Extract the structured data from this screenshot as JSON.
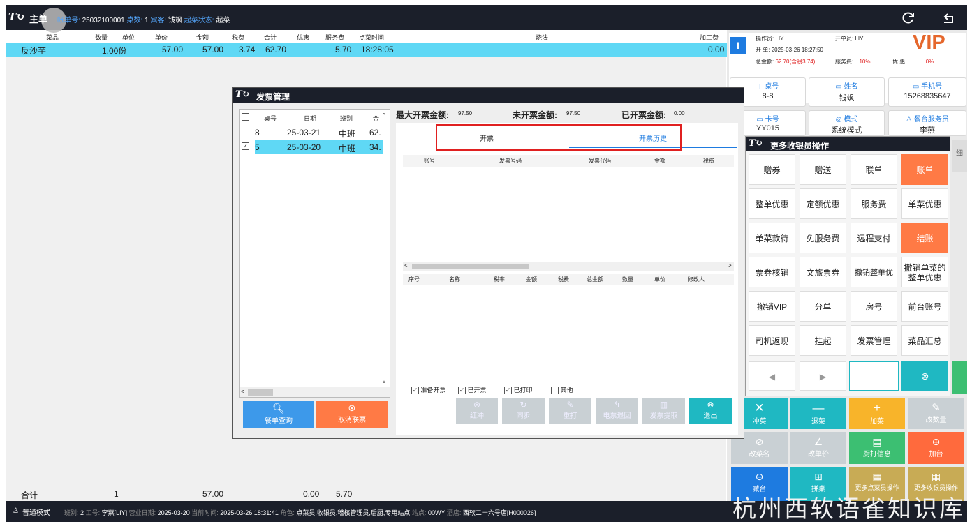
{
  "header": {
    "title": "主单",
    "order_no_label": "帐单号:",
    "order_no": "25032100001",
    "tables_label": "桌数:",
    "tables": "1",
    "guest_label": "宾客:",
    "guest": "钱飒",
    "status_label": "起菜状态:",
    "status": "起菜"
  },
  "table": {
    "columns": [
      "菜品",
      "数量",
      "单位",
      "单价",
      "金额",
      "税费",
      "合计",
      "优惠",
      "服务费",
      "点菜时间",
      "烧法",
      "加工费"
    ],
    "row": {
      "name": "反沙芋",
      "qty": "1.00份",
      "price": "57.00",
      "amount": "57.00",
      "tax": "3.74",
      "total": "62.70",
      "service": "5.70",
      "time": "18:28:05",
      "fee": "0.00"
    }
  },
  "summary": {
    "label": "合计",
    "qty": "1",
    "amount": "57.00",
    "discount": "0.00",
    "service": "5.70"
  },
  "dialog": {
    "title": "发票管理",
    "list_cols": [
      "桌号",
      "日期",
      "班别",
      "金"
    ],
    "rows": [
      {
        "no": "8",
        "date": "25-03-21",
        "shift": "中班",
        "amt": "62.",
        "checked": "",
        "sel": false
      },
      {
        "no": "5",
        "date": "25-03-20",
        "shift": "中班",
        "amt": "34.",
        "checked": "✓",
        "sel": true
      }
    ],
    "max_label": "最大开票金额:",
    "max_val": "97.50",
    "un_label": "未开票金额:",
    "un_val": "97.50",
    "done_label": "已开票金额:",
    "done_val": "0.00",
    "tab1": "开票",
    "tab2": "开票历史",
    "grid1_cols": [
      "账号",
      "发票号码",
      "发票代码",
      "金额",
      "税费"
    ],
    "grid2_cols": [
      "序号",
      "名称",
      "税率",
      "金额",
      "税费",
      "总金额",
      "数量",
      "单价",
      "修改人"
    ],
    "filters": [
      {
        "label": "准备开票",
        "mark": "✓"
      },
      {
        "label": "已开票",
        "mark": "✓"
      },
      {
        "label": "已打印",
        "mark": "✓"
      },
      {
        "label": "其他",
        "mark": ""
      }
    ],
    "btn_query": "餐单查询",
    "btn_cancel": "取消联票",
    "ops": [
      "红冲",
      "同步",
      "重打",
      "电票退回",
      "发票提取",
      "退出"
    ]
  },
  "side": {
    "operator_label": "操作员:",
    "operator": "LIY",
    "opener_label": "开单员:",
    "opener": "LIY",
    "open_label": "开 单:",
    "open_time": "2025-03-26 18:27:50",
    "vip": "VIP",
    "total_label": "总金额:",
    "total": "62.70(含税3.74)",
    "svc_label": "服务费:",
    "svc": "10%",
    "disc_label": "优 惠:",
    "disc": "0%",
    "cards": [
      {
        "label": "桌号",
        "value": "8-8"
      },
      {
        "label": "姓名",
        "value": "钱飒"
      },
      {
        "label": "手机号",
        "value": "15268835647"
      },
      {
        "label": "卡号",
        "value": "YY015"
      },
      {
        "label": "模式",
        "value": "系统模式"
      },
      {
        "label": "餐台服务员",
        "value": "李燕"
      }
    ],
    "partial": "细"
  },
  "popup": {
    "title": "更多收银员操作",
    "buttons": [
      "赠券",
      "赠送",
      "联单",
      "账单",
      "整单优惠",
      "定额优惠",
      "服务费",
      "单菜优惠",
      "单菜款待",
      "免服务费",
      "远程支付",
      "结账",
      "票券核销",
      "文旅票券",
      "撤销整单优惠",
      "撤销单菜的整单优惠",
      "撤销VIP",
      "分单",
      "房号",
      "前台账号",
      "司机返现",
      "挂起",
      "发票管理",
      "菜品汇总"
    ]
  },
  "tiles": [
    "冲菜",
    "退菜",
    "加菜",
    "改数量",
    "改菜名",
    "改单价",
    "厨打信息",
    "加台",
    "减台",
    "拼桌",
    "更多点菜员操作",
    "更多收银员操作"
  ],
  "footer": {
    "mode": "普通模式",
    "shift_label": "班别:",
    "shift": "2",
    "emp_label": "工号:",
    "emp": "李燕[LIY]",
    "bizdate_label": "营业日期:",
    "bizdate": "2025-03-20",
    "now_label": "当前时间:",
    "now": "2025-03-26 18:31:41",
    "role_label": "角色:",
    "role": "点菜员,收银员,稽核管理员,后厨,专用站点",
    "station_label": "站点:",
    "station": "00WY",
    "hotel_label": "酒店:",
    "hotel": "西软二十六号店[H000026]"
  },
  "watermark": "杭州西软语雀知识库",
  "colors": {
    "accent": "#1e7be0",
    "row_highlight": "#5fd8f5",
    "orange": "#ff7a45",
    "cyan": "#1fb8c2",
    "dark": "#1b1f2a"
  }
}
